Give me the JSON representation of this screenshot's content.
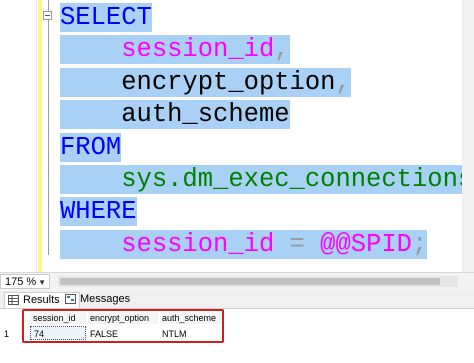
{
  "editor": {
    "lines": [
      {
        "parts": [
          {
            "t": "SELECT",
            "c": "kw"
          }
        ]
      },
      {
        "parts": [
          {
            "t": "    ",
            "c": "blk"
          },
          {
            "t": "session_id",
            "c": "pink"
          },
          {
            "t": ",",
            "c": "gray"
          }
        ]
      },
      {
        "parts": [
          {
            "t": "    ",
            "c": "blk"
          },
          {
            "t": "encrypt_option",
            "c": "blk"
          },
          {
            "t": ",",
            "c": "gray"
          }
        ]
      },
      {
        "parts": [
          {
            "t": "    ",
            "c": "blk"
          },
          {
            "t": "auth_scheme",
            "c": "blk"
          }
        ]
      },
      {
        "parts": [
          {
            "t": "FROM",
            "c": "kw"
          }
        ]
      },
      {
        "parts": [
          {
            "t": "    ",
            "c": "blk"
          },
          {
            "t": "sys.dm_exec_connections",
            "c": "grn"
          }
        ]
      },
      {
        "parts": [
          {
            "t": "WHERE",
            "c": "kw"
          }
        ]
      },
      {
        "parts": [
          {
            "t": "    ",
            "c": "blk"
          },
          {
            "t": "session_id",
            "c": "pink"
          },
          {
            "t": " = ",
            "c": "gray"
          },
          {
            "t": "@@SPID",
            "c": "pink"
          },
          {
            "t": ";",
            "c": "gray"
          }
        ]
      }
    ]
  },
  "status": {
    "zoom": "175 %"
  },
  "tabs": {
    "results": "Results",
    "messages": "Messages"
  },
  "grid": {
    "columns": [
      "session_id",
      "encrypt_option",
      "auth_scheme"
    ],
    "rows": [
      {
        "num": "1",
        "cells": [
          "74",
          "FALSE",
          "NTLM"
        ]
      }
    ]
  },
  "colors": {
    "selection": "#a8d1f5",
    "keyword": "#0000ff",
    "highlight_box": "#cc1f1f"
  }
}
